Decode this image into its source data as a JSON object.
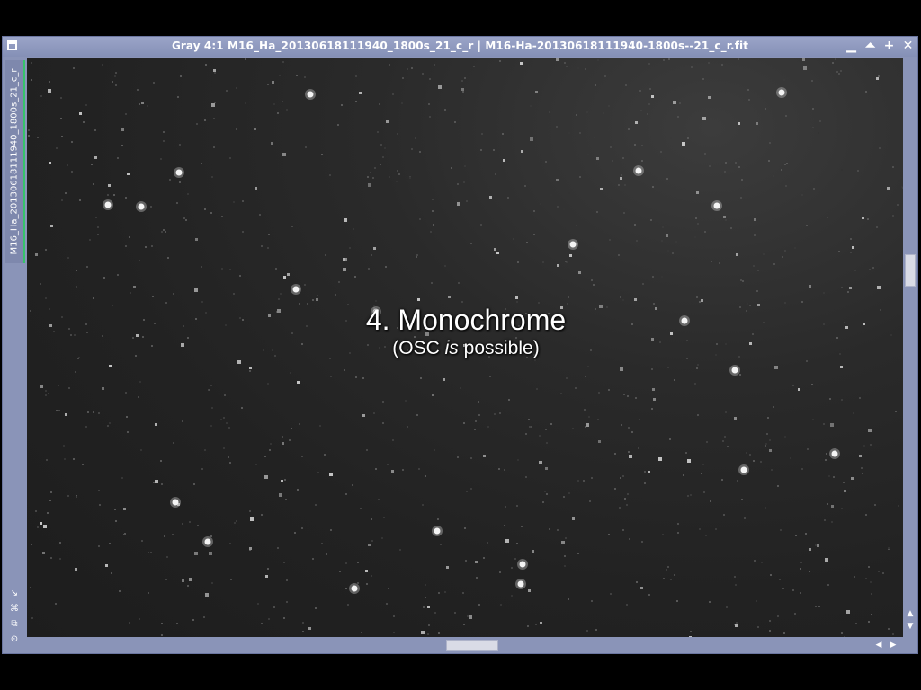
{
  "window": {
    "title": "Gray 4:1 M16_Ha_20130618111940_1800s_21_c_r | M16-Ha-20130618111940-1800s--21_c_r.fit",
    "controls": {
      "minimize": "▬",
      "shade": "⯐",
      "maximize": "✚",
      "close": "✖"
    }
  },
  "sidebar": {
    "view_tab": "M16_Ha_20130618111940_1800s_21_c_r",
    "icons": [
      "cursor-icon",
      "pin-icon",
      "clone-icon",
      "target-icon"
    ],
    "accent": "#36c36a"
  },
  "overlay": {
    "heading": "4. Monochrome",
    "sub_before": "(OSC ",
    "sub_em": "is",
    "sub_after": " possible)"
  },
  "colors": {
    "frame": "#8a94b8",
    "image_bg": "#222222"
  }
}
